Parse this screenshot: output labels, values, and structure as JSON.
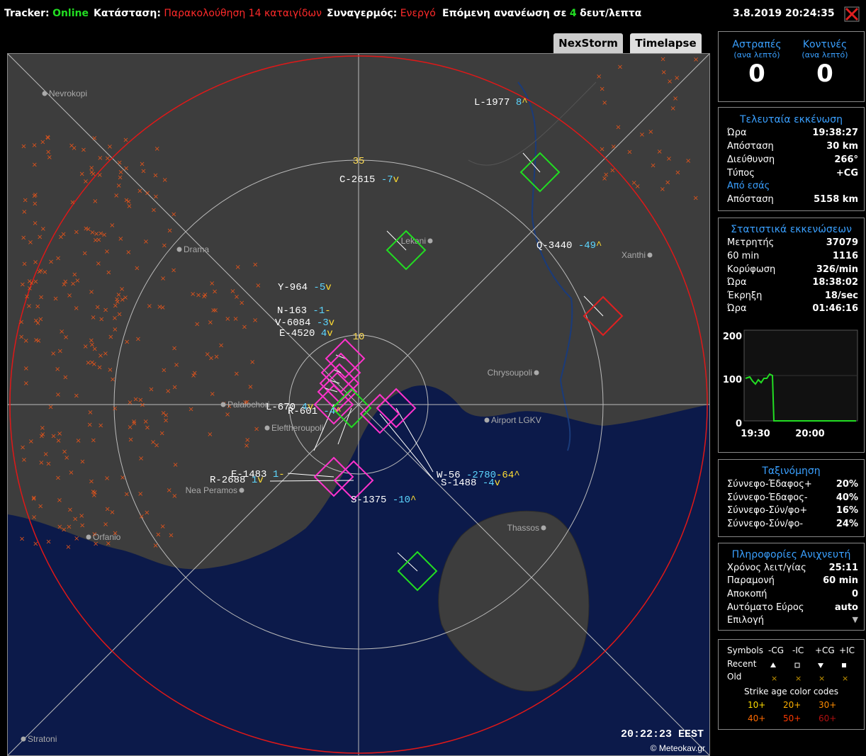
{
  "status": {
    "tracker_label": "Tracker:",
    "tracker_value": "Online",
    "state_label": "Κατάσταση:",
    "state_value": "Παρακολούθηση 14 καταιγίδων",
    "alarm_label": "Συναγερμός:",
    "alarm_value": "Ενεργό",
    "refresh_prefix": "Επόμενη ανανέωση σε",
    "refresh_value": "4",
    "refresh_suffix": "δευτ/λεπτα",
    "datetime": "3.8.2019 20:24:35"
  },
  "tabs": [
    "NexStorm",
    "Timelapse"
  ],
  "map": {
    "timestamp": "20:22:23 EEST",
    "credit": "© Meteokav.gr",
    "range_labels": [
      "35",
      "10"
    ],
    "places": [
      "Nevrokopi",
      "Drama",
      "Lekani",
      "Xanthi",
      "Chrysoupoli",
      "Palaiochori",
      "Eleftheroupoli",
      "Airport LGKV",
      "Nea Peramos",
      "Orfanio",
      "Thassos",
      "Stratoni"
    ],
    "storms": [
      {
        "id": "L-1977",
        "val": "8",
        "trend": "^"
      },
      {
        "id": "C-2615",
        "val": "-7",
        "trend": "v"
      },
      {
        "id": "Q-3440",
        "val": "-49",
        "trend": "^"
      },
      {
        "id": "Y-964",
        "val": "-5",
        "trend": "v"
      },
      {
        "id": "N-163",
        "val": "-1",
        "trend": "-"
      },
      {
        "id": "V-6084",
        "val": "-3",
        "trend": "v"
      },
      {
        "id": "E-4520",
        "val": "4",
        "trend": "v"
      },
      {
        "id": "L-670",
        "val": "4",
        "trend": "v"
      },
      {
        "id": "R-601",
        "val": "-4",
        "trend": "^"
      },
      {
        "id": "E-1483",
        "val": "1",
        "trend": "-"
      },
      {
        "id": "R-2688",
        "val": "1",
        "trend": "v"
      },
      {
        "id": "S-1375",
        "val": "-10",
        "trend": "^"
      },
      {
        "id": "W-56",
        "val": "-2780",
        "trend": "-64^"
      },
      {
        "id": "S-1488",
        "val": "-4",
        "trend": "v"
      }
    ]
  },
  "counters": {
    "strikes_label": "Αστραπές",
    "strikes_sub": "(ανα λεπτό)",
    "strikes_value": "0",
    "near_label": "Κοντινές",
    "near_sub": "(ανα λεπτό)",
    "near_value": "0"
  },
  "last_discharge": {
    "title": "Τελευταία εκκένωση",
    "rows": [
      {
        "k": "Ώρα",
        "v": "19:38:27"
      },
      {
        "k": "Απόσταση",
        "v": "30 km"
      },
      {
        "k": "Διεύθυνση",
        "v": "266°"
      },
      {
        "k": "Τύπος",
        "v": "+CG"
      }
    ],
    "from_you": "Από εσάς",
    "from_you_row": {
      "k": "Απόσταση",
      "v": "5158 km"
    }
  },
  "stats": {
    "title": "Στατιστικά εκκενώσεων",
    "rows": [
      {
        "k": "Μετρητής",
        "v": "37079"
      },
      {
        "k": "60 min",
        "v": "1116"
      },
      {
        "k": "Κορύφωση",
        "v": "326/min"
      },
      {
        "k": "Ώρα",
        "v": "18:38:02"
      },
      {
        "k": "Έκρηξη",
        "v": "18/sec"
      },
      {
        "k": "Ώρα",
        "v": "01:46:16"
      }
    ],
    "graph": {
      "y_ticks": [
        "200",
        "100",
        "0"
      ],
      "x_ticks": [
        "19:30",
        "20:00"
      ]
    }
  },
  "classification": {
    "title": "Ταξινόμηση",
    "rows": [
      {
        "k": "Σύννεφο-Έδαφος+",
        "v": "20%"
      },
      {
        "k": "Σύννεφο-Έδαφος-",
        "v": "40%"
      },
      {
        "k": "Σύννεφο-Σύν/φο+",
        "v": "16%"
      },
      {
        "k": "Σύννεφο-Σύν/φο-",
        "v": "24%"
      }
    ]
  },
  "detector": {
    "title": "Πληροφορίες Ανιχνευτή",
    "rows": [
      {
        "k": "Χρόνος λειτ/γίας",
        "v": "25:11"
      },
      {
        "k": "Παραμονή",
        "v": "60 min"
      },
      {
        "k": "Αποκοπή",
        "v": "0"
      },
      {
        "k": "Αυτόματο Εύρος",
        "v": "auto"
      }
    ],
    "select_label": "Επιλογή"
  },
  "legend": {
    "symbols": "Symbols",
    "types": [
      "-CG",
      "-IC",
      "+CG",
      "+IC"
    ],
    "recent": "Recent",
    "old": "Old",
    "age_title": "Strike age color codes",
    "ages": [
      "10+",
      "20+",
      "30+",
      "40+",
      "50+",
      "60+"
    ],
    "age_colors": [
      "#ffdd00",
      "#ffb000",
      "#ff8c00",
      "#ff6a00",
      "#ff3a00",
      "#b01010"
    ]
  },
  "colors": {
    "accent_blue": "#3aa0ff",
    "land": "#3d3d3d",
    "sea": "#0c1a4a",
    "ring_red": "#e01818",
    "storm_green": "#22dd22",
    "storm_magenta": "#ff33cc"
  }
}
